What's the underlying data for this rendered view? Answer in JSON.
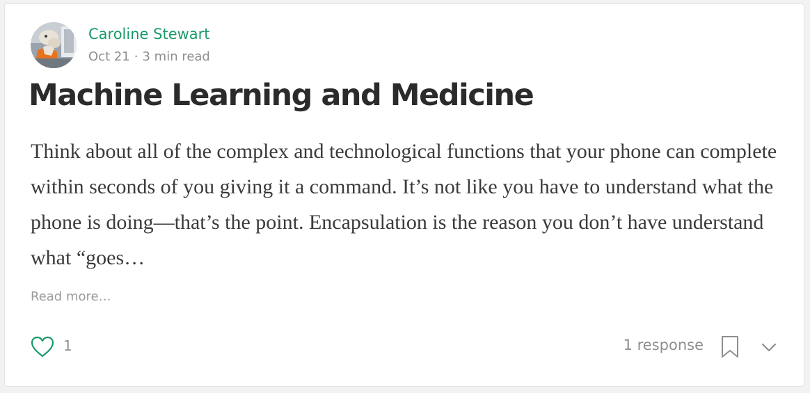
{
  "author": {
    "name": "Caroline Stewart",
    "avatar_icon": "author-avatar"
  },
  "meta": {
    "date": "Oct 21",
    "separator": "·",
    "read_time": "3 min read"
  },
  "post": {
    "title": "Machine Learning and Medicine",
    "excerpt": "Think about all of the complex and technological functions that your phone can complete within seconds of you giving it a command. It’s not like you have to understand what the phone is doing—that’s the point. Encapsulation is the reason you don’t have understand what “goes…",
    "read_more": "Read more…"
  },
  "footer": {
    "clap_icon": "heart-icon",
    "clap_count": "1",
    "responses": "1 response",
    "bookmark_icon": "bookmark-icon",
    "more_icon": "chevron-down-icon"
  },
  "colors": {
    "accent": "#1a9a6a",
    "muted": "#8e8e8e",
    "title": "#2b2b2b",
    "body": "#3b3b3b"
  }
}
